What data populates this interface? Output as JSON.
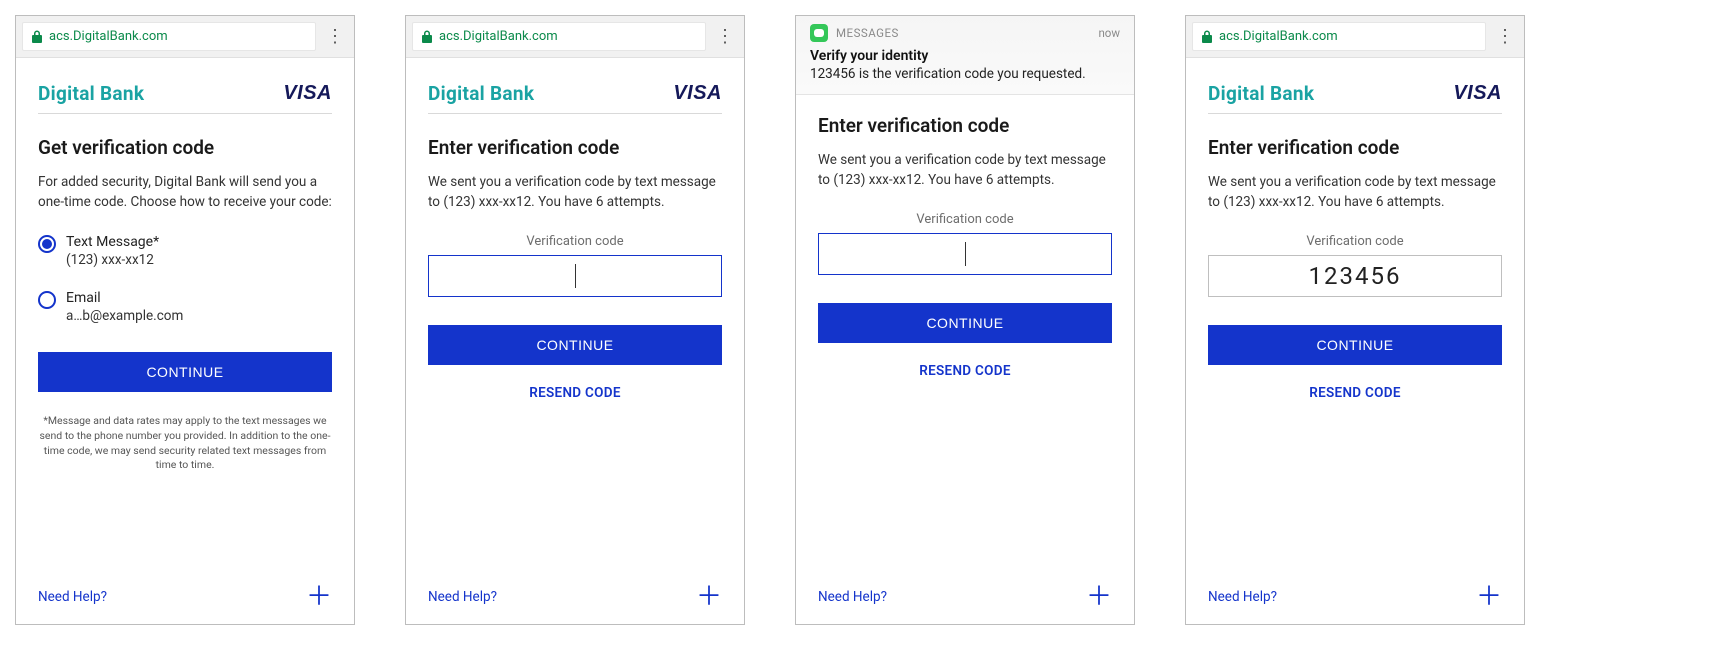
{
  "url": "acs.DigitalBank.com",
  "brand_name": "Digital Bank",
  "visa_logo_text": "VISA",
  "help_link": "Need Help?",
  "continue_label": "CONTINUE",
  "resend_label": "RESEND CODE",
  "panel1": {
    "title": "Get verification code",
    "body": "For added security, Digital Bank will send you a one-time code. Choose how to receive your code:",
    "opt_text_label": "Text Message*",
    "opt_text_value": "(123) xxx-xx12",
    "opt_email_label": "Email",
    "opt_email_value": "a…b@example.com",
    "fine_print": "*Message and data rates may apply to the text messages we send to the phone number you provided. In addition to the one-time code, we may send security related text messages from time to time."
  },
  "enter_panel": {
    "title": "Enter verification code",
    "body": "We sent you a verification code by text message to (123) xxx-xx12. You have 6 attempts.",
    "field_label": "Verification code"
  },
  "notification": {
    "app": "MESSAGES",
    "time": "now",
    "title": "Verify your identity",
    "body": "123456 is the verification code you requested."
  },
  "entered_code": "123456"
}
